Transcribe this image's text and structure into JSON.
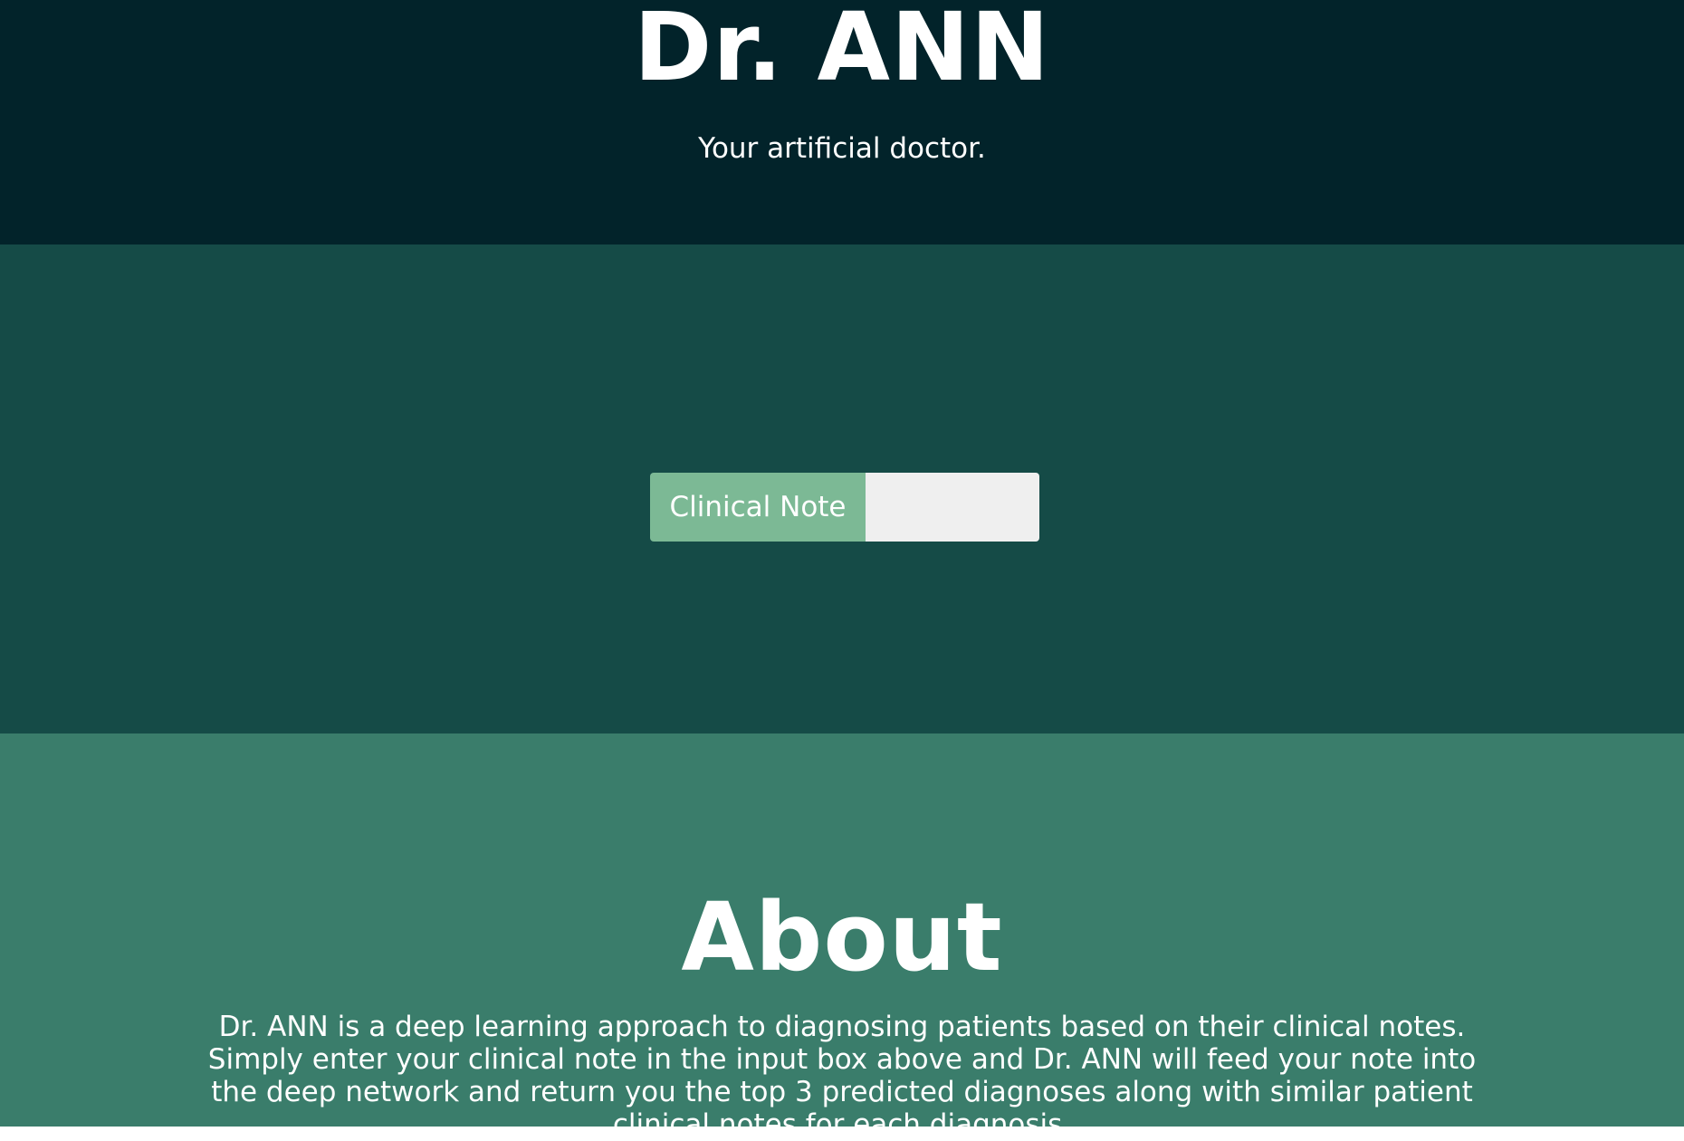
{
  "header": {
    "title": "Dr. ANN",
    "subtitle": "Your artificial doctor."
  },
  "input": {
    "label": "Clinical Note",
    "value": "",
    "placeholder": ""
  },
  "about": {
    "title": "About",
    "text": "Dr. ANN is a deep learning approach to diagnosing patients based on their clinical notes. Simply enter your clinical note in the input box above and Dr. ANN will feed your note into the deep network and return you the top 3 predicted diagnoses along with similar patient clinical notes for each diagnosis."
  },
  "colors": {
    "header_bg": "#02232a",
    "input_section_bg": "#154b47",
    "label_bg": "#7cb995",
    "field_bg": "#efefef",
    "about_bg": "#3a7d6b"
  }
}
